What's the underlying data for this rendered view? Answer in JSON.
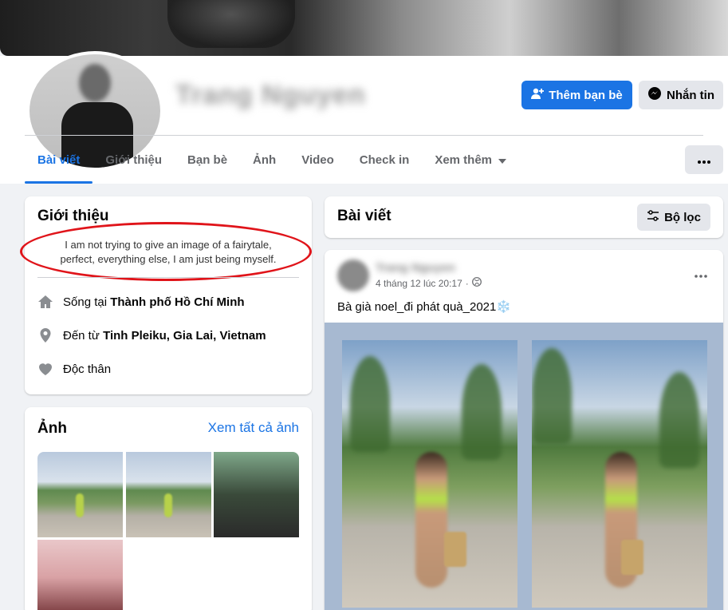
{
  "profile": {
    "name": "Trang Nguyen"
  },
  "actions": {
    "add_friend": "Thêm bạn bè",
    "message": "Nhắn tin"
  },
  "tabs": [
    {
      "label": "Bài viết"
    },
    {
      "label": "Giới thiệu"
    },
    {
      "label": "Bạn bè"
    },
    {
      "label": "Ảnh"
    },
    {
      "label": "Video"
    },
    {
      "label": "Check in"
    },
    {
      "label": "Xem thêm"
    }
  ],
  "intro": {
    "title": "Giới thiệu",
    "bio_line1": "I am not trying to give an image of a fairytale,",
    "bio_line2": "perfect, everything else, I am just being myself.",
    "lives_prefix": "Sống tại ",
    "lives_city": "Thành phố Hồ Chí Minh",
    "from_prefix": "Đến từ ",
    "from_city": "Tinh Pleiku, Gia Lai, Vietnam",
    "relationship": "Độc thân"
  },
  "photos": {
    "title": "Ảnh",
    "see_all": "Xem tất cả ảnh"
  },
  "posts": {
    "title": "Bài viết",
    "filter_label": "Bộ lọc",
    "post": {
      "author": "Trang Nguyen",
      "time": "4 tháng 12 lúc 20:17",
      "text": "Bà già noel_đi phát quà_2021❄️"
    }
  },
  "colors": {
    "accent": "#1b74e4",
    "highlight": "#e0141a"
  }
}
